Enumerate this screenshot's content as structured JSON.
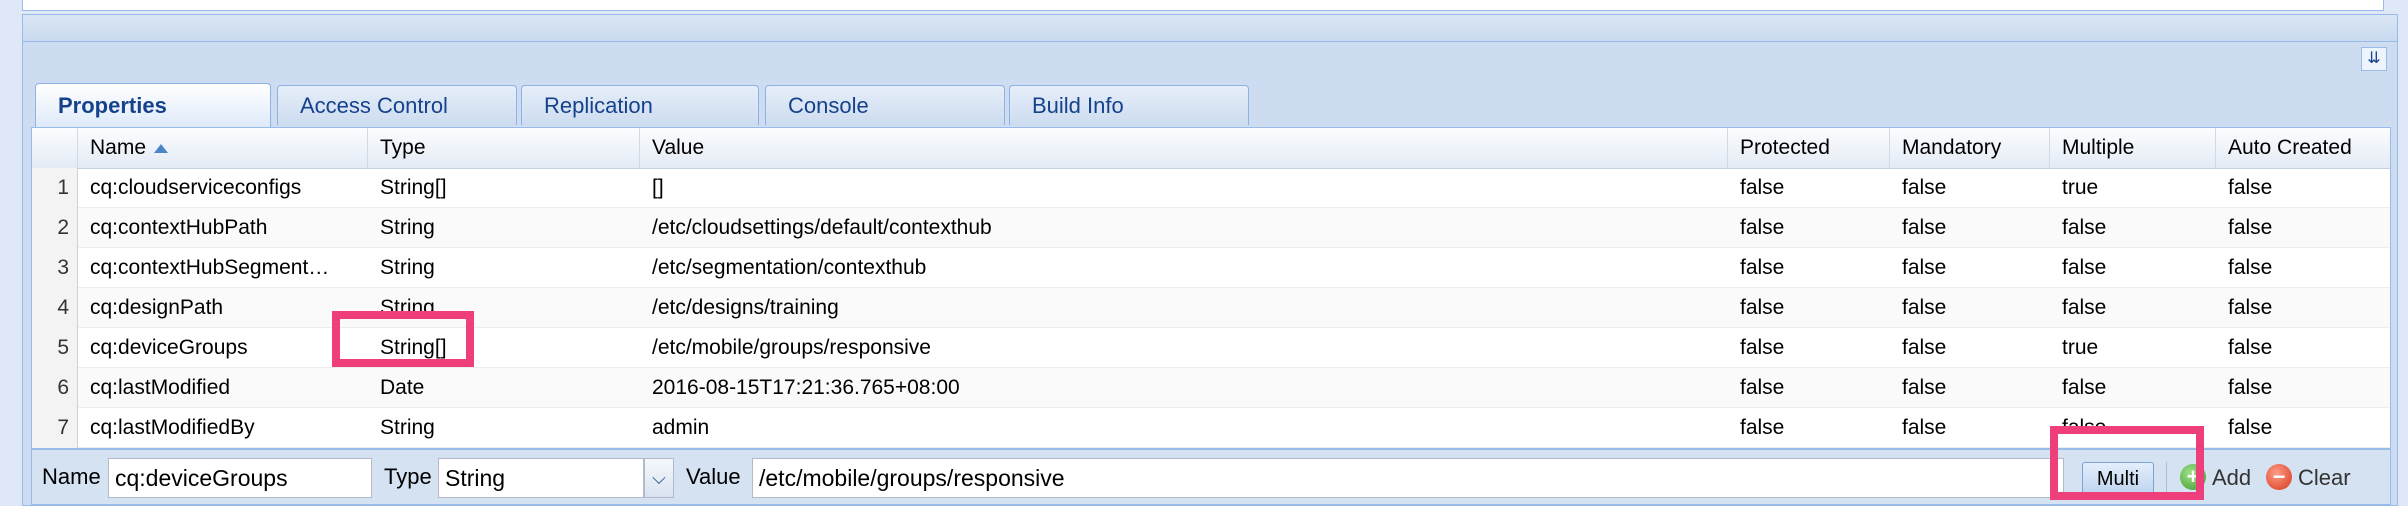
{
  "tabs": [
    "Properties",
    "Access Control",
    "Replication",
    "Console",
    "Build Info"
  ],
  "columns": {
    "name": "Name",
    "type": "Type",
    "value": "Value",
    "protected": "Protected",
    "mandatory": "Mandatory",
    "multiple": "Multiple",
    "auto_created": "Auto Created"
  },
  "rows": [
    {
      "num": "1",
      "name": "cq:cloudserviceconfigs",
      "type": "String[]",
      "value": "[]",
      "protected": "false",
      "mandatory": "false",
      "multiple": "true",
      "auto_created": "false"
    },
    {
      "num": "2",
      "name": "cq:contextHubPath",
      "type": "String",
      "value": "/etc/cloudsettings/default/contexthub",
      "protected": "false",
      "mandatory": "false",
      "multiple": "false",
      "auto_created": "false"
    },
    {
      "num": "3",
      "name": "cq:contextHubSegment…",
      "type": "String",
      "value": "/etc/segmentation/contexthub",
      "protected": "false",
      "mandatory": "false",
      "multiple": "false",
      "auto_created": "false"
    },
    {
      "num": "4",
      "name": "cq:designPath",
      "type": "String",
      "value": "/etc/designs/training",
      "protected": "false",
      "mandatory": "false",
      "multiple": "false",
      "auto_created": "false"
    },
    {
      "num": "5",
      "name": "cq:deviceGroups",
      "type": "String[]",
      "value": "/etc/mobile/groups/responsive",
      "protected": "false",
      "mandatory": "false",
      "multiple": "true",
      "auto_created": "false"
    },
    {
      "num": "6",
      "name": "cq:lastModified",
      "type": "Date",
      "value": "2016-08-15T17:21:36.765+08:00",
      "protected": "false",
      "mandatory": "false",
      "multiple": "false",
      "auto_created": "false"
    },
    {
      "num": "7",
      "name": "cq:lastModifiedBy",
      "type": "String",
      "value": "admin",
      "protected": "false",
      "mandatory": "false",
      "multiple": "false",
      "auto_created": "false"
    }
  ],
  "editor": {
    "name_label": "Name",
    "name_value": "cq:deviceGroups",
    "type_label": "Type",
    "type_value": "String",
    "value_label": "Value",
    "value_value": "/etc/mobile/groups/responsive",
    "multi_label": "Multi",
    "add_label": "Add",
    "clear_label": "Clear"
  },
  "icons": {
    "collapse": "double-chevron-down-icon",
    "sort": "sort-ascending-icon",
    "dropdown": "chevron-down-icon",
    "add": "add-icon",
    "clear": "clear-icon"
  },
  "colors": {
    "highlight": "#ee3f7a",
    "tab_text": "#15428b"
  }
}
